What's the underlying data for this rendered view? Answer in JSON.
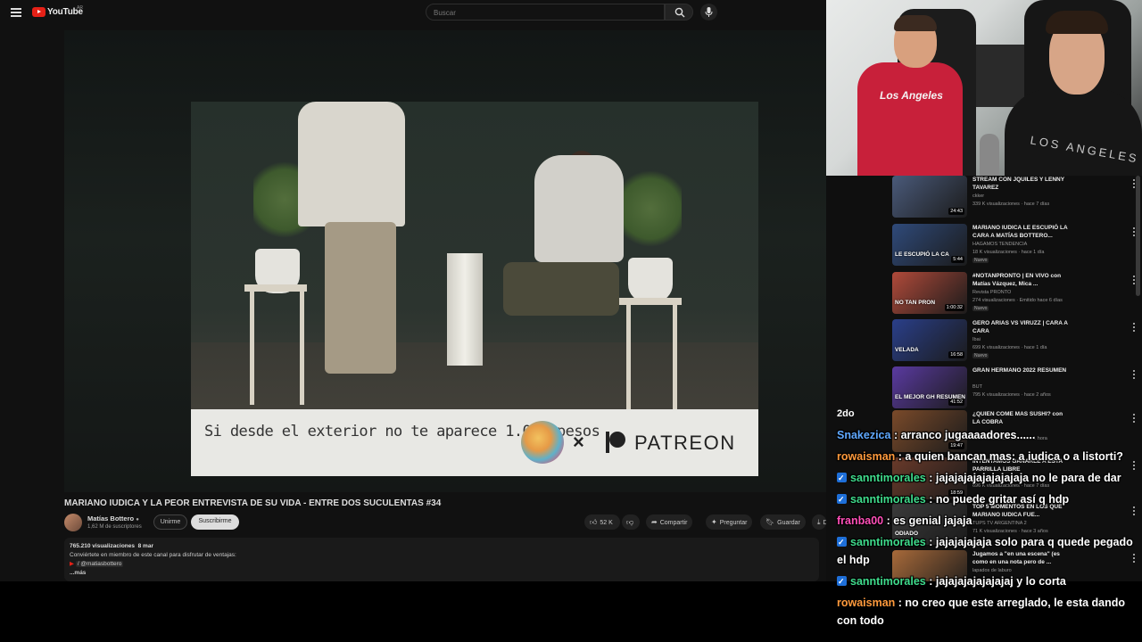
{
  "youtube": {
    "logo_text": "YouTube",
    "logo_region": "AR",
    "search_placeholder": "Buscar",
    "video": {
      "banner_text": "Si desde el exterior no te aparece 1.000 pesos",
      "banner_x": "×",
      "banner_brand": "PATREON"
    },
    "title": "MARIANO IUDICA Y LA PEOR ENTREVISTA DE SU VIDA - ENTRE DOS SUCULENTAS #34",
    "channel": {
      "name": "Matías Bottero",
      "verified_glyph": "●",
      "subscribers": "1,62 M de suscriptores",
      "join_label": "Unirme",
      "subscribe_label": "Suscribirme"
    },
    "actions": {
      "likes": "52 K",
      "share": "Compartir",
      "ask": "Preguntar",
      "save": "Guardar",
      "download": "De"
    },
    "description": {
      "views": "765.210 visualizaciones",
      "date": "8 mar",
      "line1": "Conviértete en miembro de este canal para disfrutar de ventajas:",
      "line2": "/ @matiasbottero",
      "more": "...más"
    }
  },
  "webcam": {
    "shirt_text": "Los Angeles",
    "hoodie_text": "LOS ANGELES"
  },
  "recommendations": [
    {
      "title": "STREAM CON JQUILES Y LENNY TAVAREZ",
      "channel": "ckker",
      "meta": "339 K visualizaciones · hace 7 días",
      "duration": "24:43",
      "badge": "",
      "thumb_label": "",
      "thumb_color": "#4a5a7a"
    },
    {
      "title": "MARIANO IUDICA LE ESCUPIÓ LA CARA A MATÍAS BOTTERO...",
      "channel": "HAGAMOS TENDENCIA",
      "meta": "18 K visualizaciones · hace 1 día",
      "duration": "5:44",
      "badge": "Nuevo",
      "thumb_label": "LE ESCUPIÓ LA CA",
      "thumb_color": "#2f4a7a"
    },
    {
      "title": "#NOTANPRONTO | EN VIVO con Matías Vázquez, Mica ...",
      "channel": "Revista PRONTO",
      "meta": "274 visualizaciones · Emitido hace 6 días",
      "duration": "1:00:32",
      "badge": "Nuevo",
      "thumb_label": "NO TAN PRON",
      "thumb_color": "#b04a3a"
    },
    {
      "title": "GERO ARIAS VS VIRUZZ | CARA A CARA",
      "channel": "Ibai",
      "meta": "699 K visualizaciones · hace 1 día",
      "duration": "16:58",
      "badge": "Nuevo",
      "thumb_label": "VELADA",
      "thumb_color": "#2a3f8a"
    },
    {
      "title": "GRAN HERMANO 2022 RESUMEN",
      "channel": "BUT",
      "meta": "795 K visualizaciones · hace 2 años",
      "duration": "41:52",
      "badge": "",
      "thumb_label": "EL MEJOR GH RESUMEN",
      "thumb_color": "#5a3aa0"
    },
    {
      "title": "¿QUIEN COME MAS SUSHI? con LA COBRA",
      "channel": "",
      "meta": "36 K visualizaciones · hace 1 hora",
      "duration": "19:47",
      "badge": "",
      "thumb_label": "",
      "thumb_color": "#7a4a2a"
    },
    {
      "title": "INTENTAMOS GANARLE A ESTA PARRILLA LIBRE",
      "channel": "",
      "meta": "696 K visualizaciones · hace 7 días",
      "duration": "18:59",
      "badge": "",
      "thumb_label": "",
      "thumb_color": "#6a3a2a"
    },
    {
      "title": "TOP 5 MOMENTOS EN LOS QUE MARIANO IUDICA FUE...",
      "channel": "TUPS TV ARGENTINA 2",
      "meta": "71 K visualizaciones · hace 3 años",
      "duration": "",
      "badge": "",
      "thumb_label": "ODIADO",
      "thumb_color": "#3a3a3a"
    },
    {
      "title": "Jugamos a \"en una escena\" (es como en una nota pero de ...",
      "channel": "lapados de laburo",
      "meta": "",
      "duration": "",
      "badge": "",
      "thumb_label": "",
      "thumb_color": "#a86a3a"
    }
  ],
  "chat": {
    "partial_top": "2do",
    "messages": [
      {
        "user": "Snakezica",
        "color": "#5fa8ff",
        "badge": false,
        "text": "arranco jugaaaadores......"
      },
      {
        "user": "rowaisman",
        "color": "#ff9a3c",
        "badge": false,
        "text": "a quien bancan mas: a iudica o a listorti?"
      },
      {
        "user": "sanntimorales",
        "color": "#3fdc8c",
        "badge": true,
        "text": "jajajajajajajajajaja no le para de dar"
      },
      {
        "user": "sanntimorales",
        "color": "#3fdc8c",
        "badge": true,
        "text": "no puede gritar así q hdp"
      },
      {
        "user": "franba00",
        "color": "#ff4fb8",
        "badge": false,
        "text": "es genial jajaja"
      },
      {
        "user": "sanntimorales",
        "color": "#3fdc8c",
        "badge": true,
        "text": "jajajajajaja solo para q quede pegado el hdp"
      },
      {
        "user": "sanntimorales",
        "color": "#3fdc8c",
        "badge": true,
        "text": "jajajajajajajajaj y lo corta"
      },
      {
        "user": "rowaisman",
        "color": "#ff9a3c",
        "badge": false,
        "text": "no creo que este arreglado, le esta dando con todo"
      }
    ]
  }
}
